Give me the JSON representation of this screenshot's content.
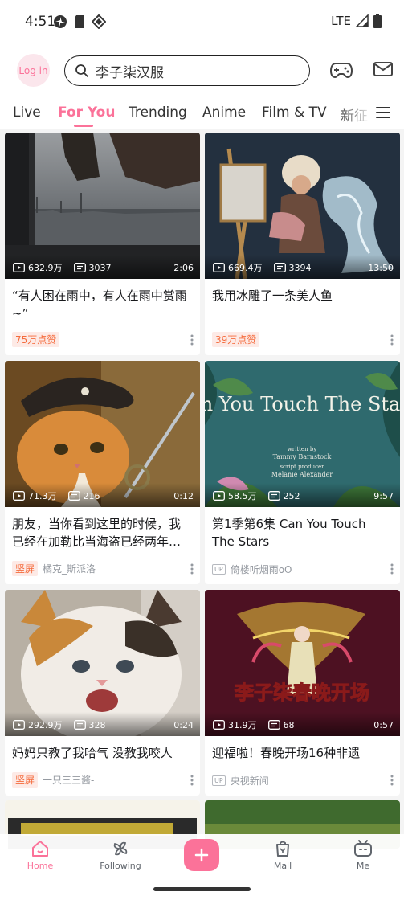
{
  "status_bar": {
    "time": "4:51",
    "network": "LTE"
  },
  "header": {
    "login_label": "Log in",
    "search_text": "李子柒汉服"
  },
  "tabs": [
    {
      "label": "Live"
    },
    {
      "label": "For You",
      "active": true
    },
    {
      "label": "Trending"
    },
    {
      "label": "Anime"
    },
    {
      "label": "Film & TV"
    },
    {
      "label": "新征"
    }
  ],
  "cards": [
    {
      "views": "632.9万",
      "comments": "3037",
      "duration": "2:06",
      "title": "“有人困在雨中，有人在雨中赏雨~”",
      "badge": "75万点赞"
    },
    {
      "views": "669.4万",
      "comments": "3394",
      "duration": "13:50",
      "title": "我用冰雕了一条美人鱼",
      "badge": "39万点赞"
    },
    {
      "views": "71.3万",
      "comments": "216",
      "duration": "0:12",
      "title": "朋友，当你看到这里的时候，我已经在加勒比当海盗已经两年…",
      "badge": "竖屏",
      "author": "橘克_斯派洛"
    },
    {
      "views": "58.5万",
      "comments": "252",
      "duration": "9:57",
      "title": "第1季第6集 Can You Touch The Stars",
      "author": "倚楼听烟雨oO",
      "thumb_title": "Can You Touch The Stars?",
      "thumb_credit_1": "written by",
      "thumb_credit_2": "Tammy Barnstock",
      "thumb_credit_3": "script producer",
      "thumb_credit_4": "Melanie Alexander"
    },
    {
      "views": "292.9万",
      "comments": "328",
      "duration": "0:24",
      "title": "妈妈只教了我哈气 没教我咬人",
      "badge": "竖屏",
      "author": "一只三三酱-"
    },
    {
      "views": "31.9万",
      "comments": "68",
      "duration": "0:57",
      "title": "迎福啦！春晚开场16种非遗",
      "author": "央视新闻",
      "thumb_caption": "李子柒春晚开场"
    }
  ],
  "nav": [
    {
      "label": "Home",
      "active": true
    },
    {
      "label": "Following"
    },
    {
      "label": "Mall"
    },
    {
      "label": "Me"
    }
  ],
  "colors": {
    "accent": "#fb7299",
    "badge_text": "#f56c3d",
    "badge_bg": "#fdeae6"
  }
}
